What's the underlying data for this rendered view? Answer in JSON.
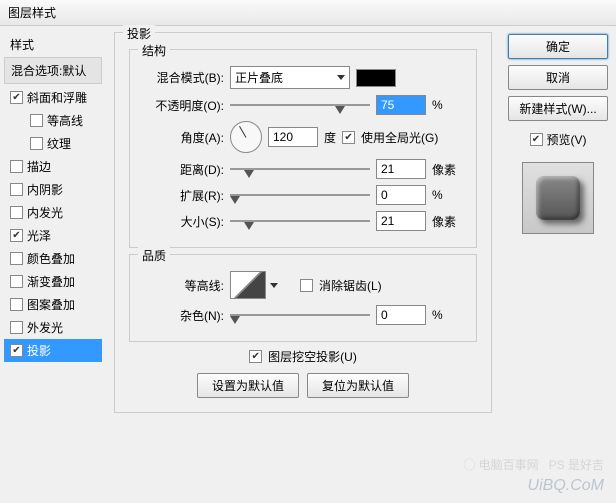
{
  "title": "图层样式",
  "left": {
    "styles_label": "样式",
    "blend_label": "混合选项:默认",
    "items": [
      {
        "label": "斜面和浮雕",
        "checked": true,
        "sub": false
      },
      {
        "label": "等高线",
        "checked": false,
        "sub": true
      },
      {
        "label": "纹理",
        "checked": false,
        "sub": true
      },
      {
        "label": "描边",
        "checked": false,
        "sub": false
      },
      {
        "label": "内阴影",
        "checked": false,
        "sub": false
      },
      {
        "label": "内发光",
        "checked": false,
        "sub": false
      },
      {
        "label": "光泽",
        "checked": true,
        "sub": false
      },
      {
        "label": "颜色叠加",
        "checked": false,
        "sub": false
      },
      {
        "label": "渐变叠加",
        "checked": false,
        "sub": false
      },
      {
        "label": "图案叠加",
        "checked": false,
        "sub": false
      },
      {
        "label": "外发光",
        "checked": false,
        "sub": false
      },
      {
        "label": "投影",
        "checked": true,
        "sub": false,
        "selected": true
      }
    ]
  },
  "center": {
    "panel_title": "投影",
    "structure_title": "结构",
    "blend_mode_label": "混合模式(B):",
    "blend_mode_value": "正片叠底",
    "opacity_label": "不透明度(O):",
    "opacity_value": "75",
    "opacity_unit": "%",
    "angle_label": "角度(A):",
    "angle_value": "120",
    "angle_unit": "度",
    "global_light_label": "使用全局光(G)",
    "global_light_checked": true,
    "distance_label": "距离(D):",
    "distance_value": "21",
    "distance_unit": "像素",
    "spread_label": "扩展(R):",
    "spread_value": "0",
    "spread_unit": "%",
    "size_label": "大小(S):",
    "size_value": "21",
    "size_unit": "像素",
    "quality_title": "品质",
    "contour_label": "等高线:",
    "antialias_label": "消除锯齿(L)",
    "antialias_checked": false,
    "noise_label": "杂色(N):",
    "noise_value": "0",
    "noise_unit": "%",
    "knockout_label": "图层挖空投影(U)",
    "knockout_checked": true,
    "make_default": "设置为默认值",
    "reset_default": "复位为默认值"
  },
  "right": {
    "ok": "确定",
    "cancel": "取消",
    "new_style": "新建样式(W)...",
    "preview_label": "预览(V)",
    "preview_checked": true
  },
  "watermark": "UiBQ.CoM"
}
